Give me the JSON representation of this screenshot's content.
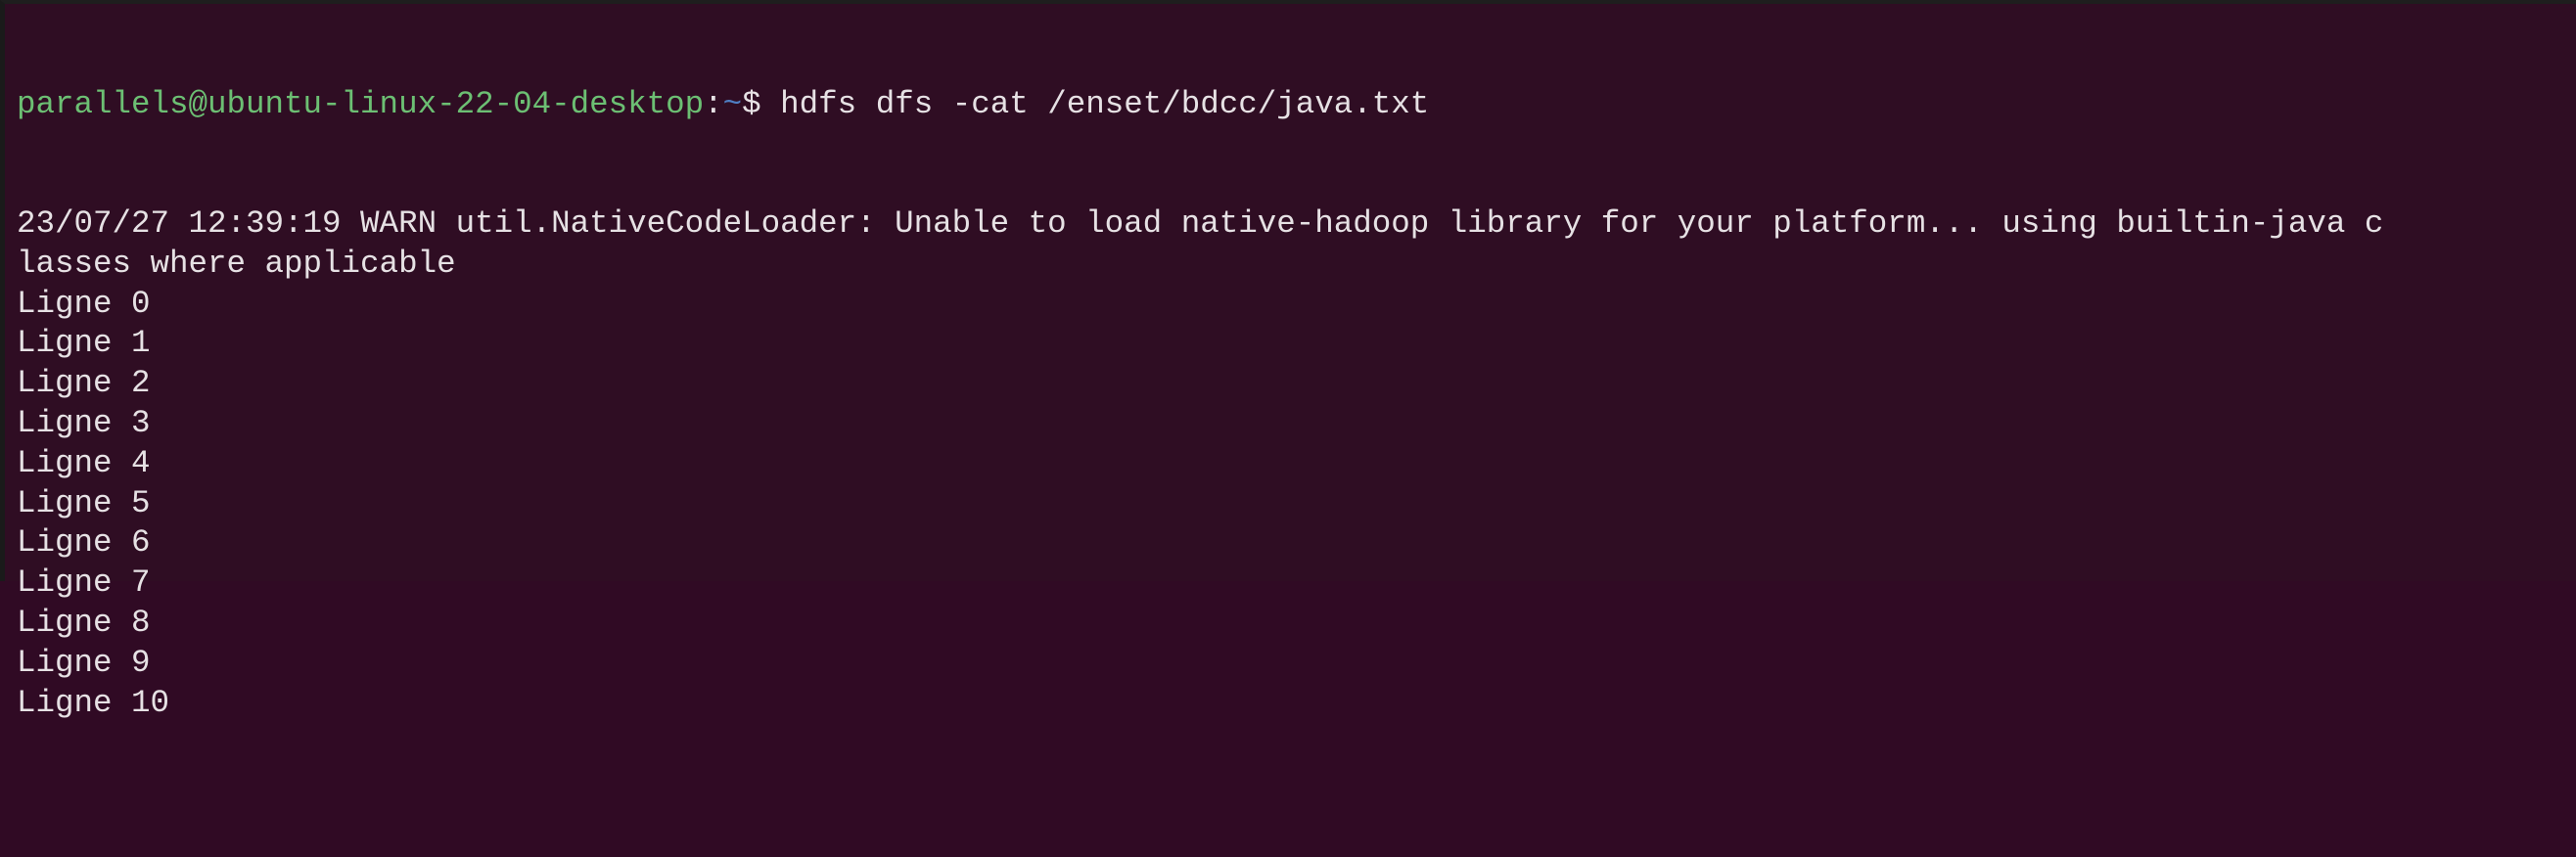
{
  "terminal": {
    "prompt_user_host": "parallels@ubuntu-linux-22-04-desktop",
    "prompt_colon": ":",
    "prompt_path": "~",
    "prompt_symbol": "$ ",
    "command": "hdfs dfs -cat /enset/bdcc/java.txt",
    "output": [
      "23/07/27 12:39:19 WARN util.NativeCodeLoader: Unable to load native-hadoop library for your platform... using builtin-java c",
      "lasses where applicable",
      "Ligne 0",
      "Ligne 1",
      "Ligne 2",
      "Ligne 3",
      "Ligne 4",
      "Ligne 5",
      "Ligne 6",
      "Ligne 7",
      "Ligne 8",
      "Ligne 9",
      "Ligne 10"
    ],
    "colors": {
      "background": "#300a24",
      "prompt_user": "#6cbf73",
      "prompt_path": "#4f7fc4",
      "text": "#e6e1e4"
    }
  }
}
